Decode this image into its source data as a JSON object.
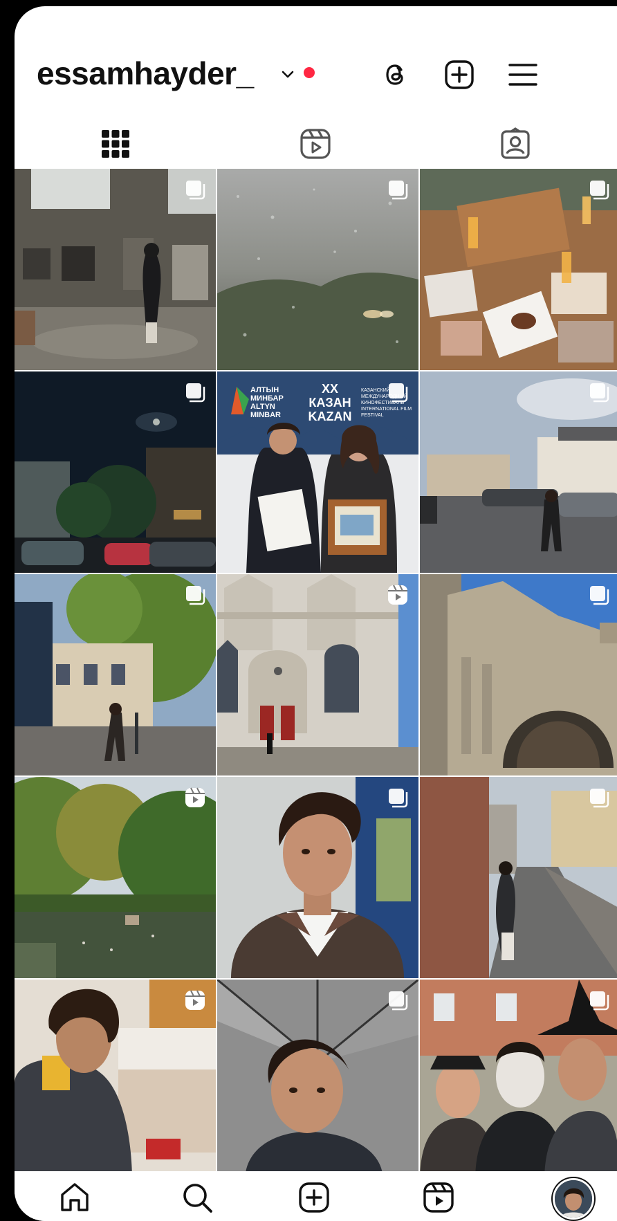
{
  "profile": {
    "username": "essamhayder_",
    "notification_color": "#ff2742"
  },
  "header_icons": [
    "threads-icon",
    "create-post-icon",
    "menu-icon"
  ],
  "tabs": [
    {
      "id": "posts",
      "icon": "grid-icon",
      "active": true
    },
    {
      "id": "reels",
      "icon": "reels-icon",
      "active": false
    },
    {
      "id": "tagged",
      "icon": "tagged-icon",
      "active": false
    }
  ],
  "grid": [
    {
      "badge": "multi-post-icon",
      "scene": "courtyard"
    },
    {
      "badge": "multi-post-icon",
      "scene": "rainy-window"
    },
    {
      "badge": "multi-post-icon",
      "scene": "table-photos"
    },
    {
      "badge": "multi-post-icon",
      "scene": "moon-street"
    },
    {
      "badge": "multi-post-icon",
      "scene": "festival-award"
    },
    {
      "badge": "multi-post-icon",
      "scene": "street-cars"
    },
    {
      "badge": "multi-post-icon",
      "scene": "town-street"
    },
    {
      "badge": "reel-icon",
      "scene": "church-front"
    },
    {
      "badge": "multi-post-icon",
      "scene": "cathedral-arch"
    },
    {
      "badge": "reel-icon",
      "scene": "park-pond"
    },
    {
      "badge": "multi-post-icon",
      "scene": "selfie-jacket"
    },
    {
      "badge": "multi-post-icon",
      "scene": "cobbled-street"
    },
    {
      "badge": "reel-icon",
      "scene": "kitchen"
    },
    {
      "badge": "multi-post-icon",
      "scene": "umbrella-selfie"
    },
    {
      "badge": "multi-post-icon",
      "scene": "costume-group"
    }
  ],
  "festival_banner": {
    "left": "АЛТЫН МИНБАР ALTYN MINBAR",
    "center": "XX КАЗАН KAZAN",
    "right": "КАЗАНСКИЙ МЕЖДУНАРОДНЫЙ КИНОФЕСТИВАЛЬ INTERNATIONAL FILM FESTIVAL"
  },
  "bottom_nav": [
    "home-icon",
    "search-icon",
    "create-icon",
    "reels-icon",
    "profile-avatar"
  ]
}
